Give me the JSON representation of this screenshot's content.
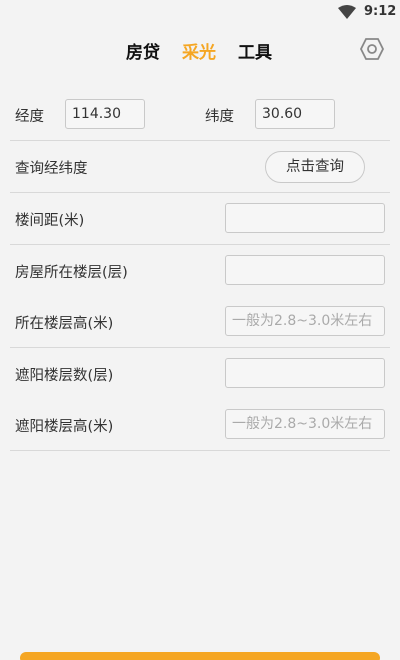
{
  "status_bar": {
    "time": "9:12"
  },
  "tabs": [
    {
      "label": "房贷",
      "active": false
    },
    {
      "label": "采光",
      "active": true
    },
    {
      "label": "工具",
      "active": false
    }
  ],
  "colors": {
    "accent": "#f5a623"
  },
  "coords": {
    "longitude_label": "经度",
    "longitude_value": "114.30",
    "latitude_label": "纬度",
    "latitude_value": "30.60"
  },
  "query": {
    "label": "查询经纬度",
    "button": "点击查询"
  },
  "fields": [
    {
      "label": "楼间距(米)",
      "value": "",
      "placeholder": ""
    },
    {
      "label": "房屋所在楼层(层)",
      "value": "",
      "placeholder": ""
    },
    {
      "label": "所在楼层高(米)",
      "value": "",
      "placeholder": "一般为2.8~3.0米左右"
    },
    {
      "label": "遮阳楼层数(层)",
      "value": "",
      "placeholder": ""
    },
    {
      "label": "遮阳楼层高(米)",
      "value": "",
      "placeholder": "一般为2.8~3.0米左右"
    }
  ]
}
